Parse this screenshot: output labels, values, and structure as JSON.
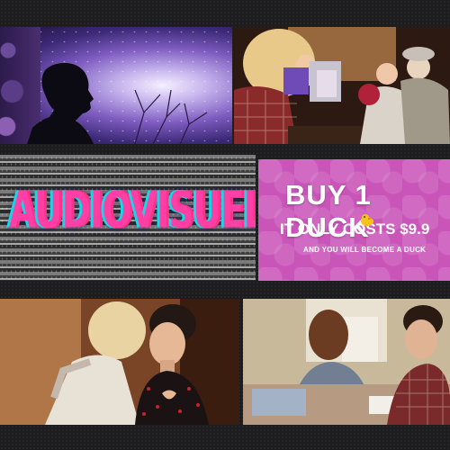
{
  "tiles": {
    "audiovisuel": {
      "title": "AUDIOVISUEL"
    },
    "duck": {
      "line1": "BUY 1 DUCK",
      "line2": "IT ONLY COSTS $9.9",
      "line3": "AND YOU WILL BECOME A DUCK",
      "background": "#c955b9",
      "icon": "duck-emoji-icon"
    },
    "silhouette": {
      "icon": "silhouette-image"
    },
    "dolls": {
      "icon": "girl-with-dolls-image"
    },
    "couple": {
      "icon": "couple-image"
    },
    "table": {
      "icon": "people-at-table-image"
    }
  }
}
